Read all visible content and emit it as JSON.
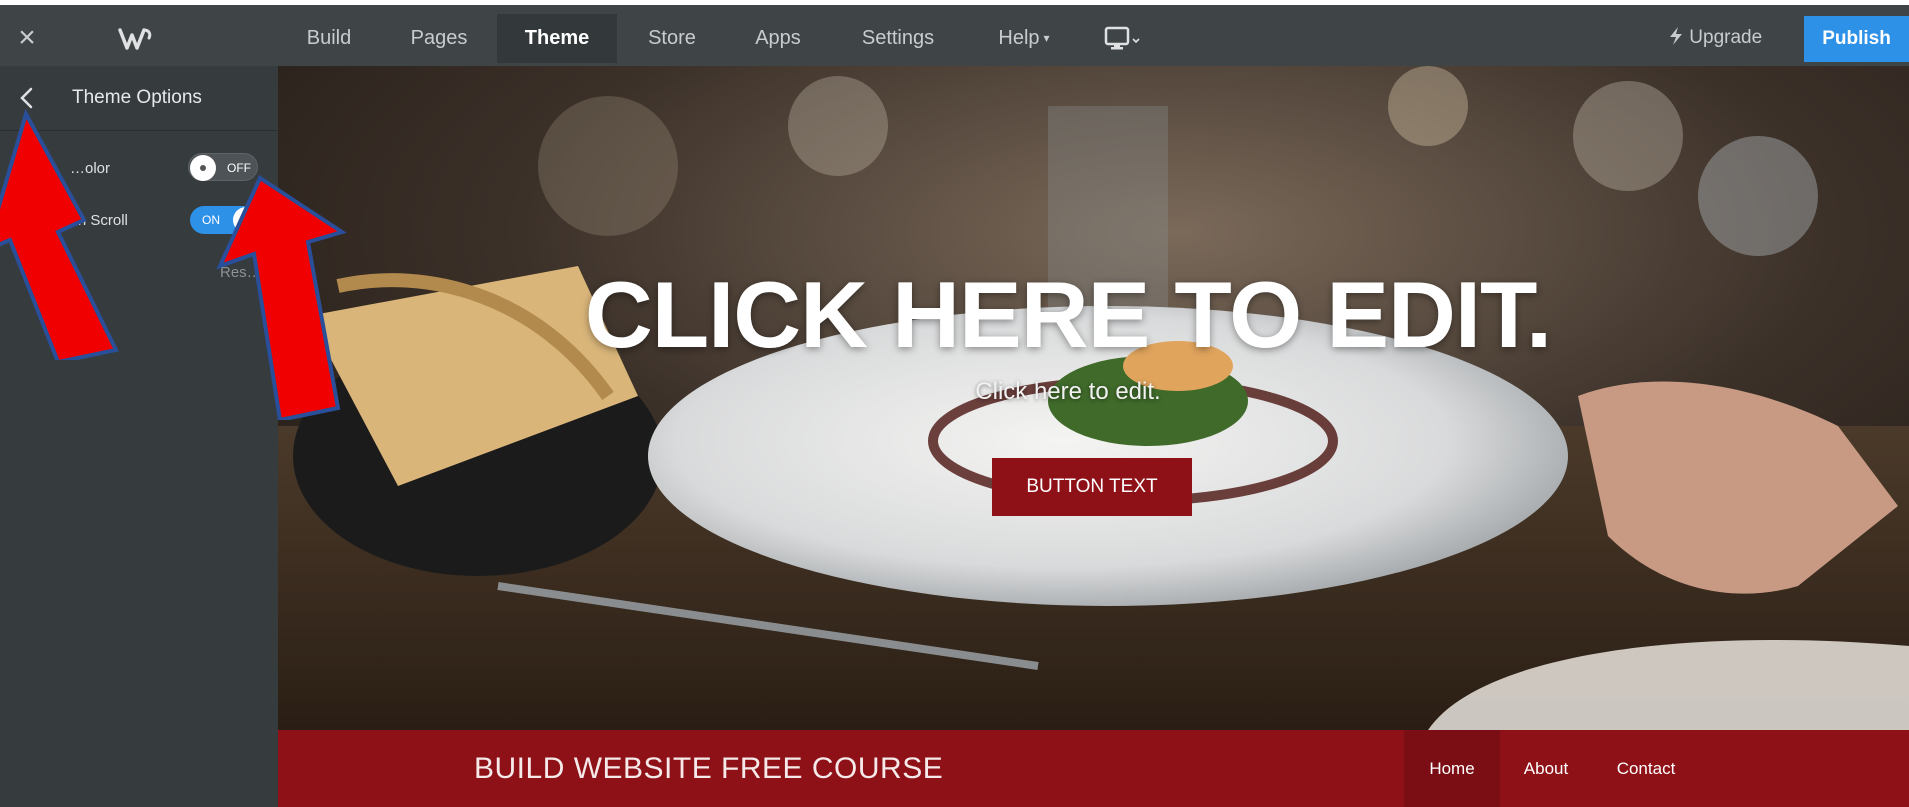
{
  "toolbar": {
    "close_icon": "close-icon",
    "logo_icon": "weebly-logo-icon",
    "tabs": [
      {
        "label": "Build"
      },
      {
        "label": "Pages"
      },
      {
        "label": "Theme",
        "active": true
      },
      {
        "label": "Store"
      },
      {
        "label": "Apps"
      },
      {
        "label": "Settings"
      },
      {
        "label": "Help",
        "caret": "▾"
      }
    ],
    "device_icon": "desktop-monitor-icon",
    "upgrade_label": "Upgrade",
    "publish_label": "Publish",
    "publish_color": "#2e91e8"
  },
  "sidebar": {
    "title": "Theme Options",
    "options": [
      {
        "label": "…olor",
        "state": "OFF"
      },
      {
        "label": "H… …e on Scroll",
        "state": "ON"
      }
    ],
    "reset_label": "Res…"
  },
  "hero": {
    "title": "CLICK HERE TO EDIT.",
    "subtitle": "Click here to edit.",
    "button_label": "BUTTON TEXT",
    "accent_color": "#8e1118"
  },
  "site_footer": {
    "site_title": "BUILD WEBSITE FREE COURSE",
    "nav": [
      {
        "label": "Home",
        "active": true
      },
      {
        "label": "About"
      },
      {
        "label": "Contact"
      }
    ]
  }
}
